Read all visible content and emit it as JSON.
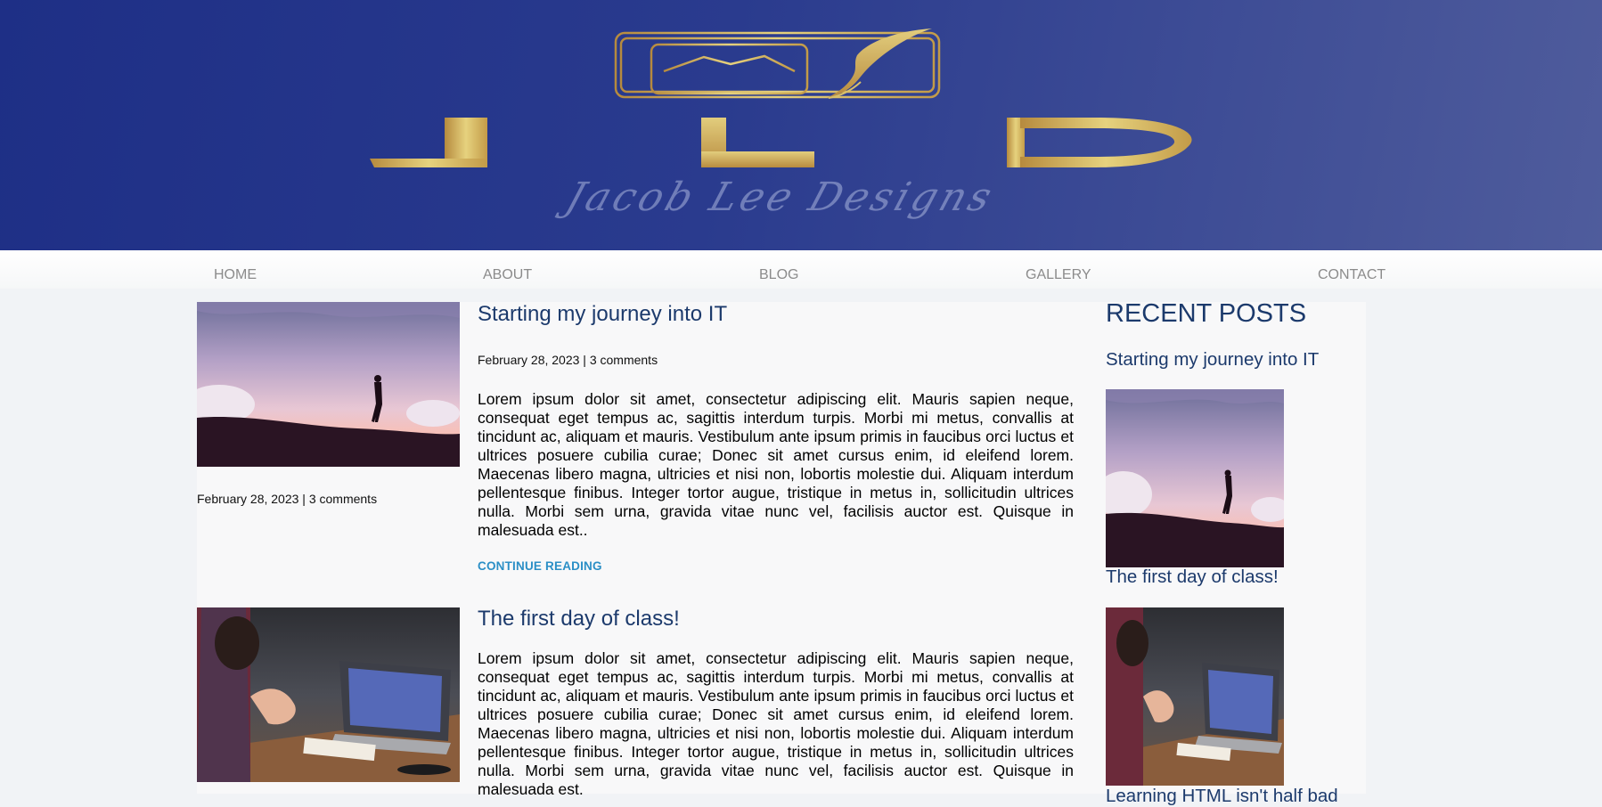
{
  "header": {
    "logo_letters": [
      "J",
      "L",
      "D"
    ],
    "logo_script": "Jacob Lee Designs"
  },
  "nav": {
    "items": [
      "HOME",
      "ABOUT",
      "BLOG",
      "GALLERY",
      "CONTACT"
    ]
  },
  "posts": [
    {
      "title": "Starting my journey into IT",
      "meta": "February 28, 2023 | 3 comments",
      "side_meta": "February 28, 2023 | 3 comments",
      "excerpt": "Lorem ipsum dolor sit amet, consectetur adipiscing elit. Mauris sapien neque, consequat eget tempus ac, sagittis interdum turpis. Morbi mi metus, convallis at tincidunt ac, aliquam et mauris. Vestibulum ante ipsum primis in faucibus orci luctus et ultrices posuere cubilia curae; Donec sit amet cursus enim, id eleifend lorem. Maecenas libero magna, ultricies et nisi non, lobortis molestie dui. Aliquam interdum pellentesque finibus. Integer tortor augue, tristique in metus in, sollicitudin ultrices nulla. Morbi sem urna, gravida vitae nunc vel, facilisis auctor est. Quisque in malesuada est..",
      "continue_label": "CONTINUE READING"
    },
    {
      "title": "The first day of class!",
      "excerpt": "Lorem ipsum dolor sit amet, consectetur adipiscing elit. Mauris sapien neque, consequat eget tempus ac, sagittis interdum turpis. Morbi mi metus, convallis at tincidunt ac, aliquam et mauris. Vestibulum ante ipsum primis in faucibus orci luctus et ultrices posuere cubilia curae; Donec sit amet cursus enim, id eleifend lorem. Maecenas libero magna, ultricies et nisi non, lobortis molestie dui. Aliquam interdum pellentesque finibus. Integer tortor augue, tristique in metus in, sollicitudin ultrices nulla. Morbi sem urna, gravida vitae nunc vel, facilisis auctor est. Quisque in malesuada est."
    }
  ],
  "sidebar": {
    "heading": "RECENT POSTS",
    "posts": [
      "Starting my journey into IT",
      "The first day of class!",
      "Learning HTML isn't half bad"
    ]
  },
  "colors": {
    "header_blue": "#1e2f86",
    "gold": "#c9a44a",
    "title_navy": "#1c3a6c",
    "link_blue": "#2b8fc6",
    "nav_gray": "#8b8b8b"
  },
  "icons": {
    "logo": "jld-logo-frame-with-quill"
  }
}
